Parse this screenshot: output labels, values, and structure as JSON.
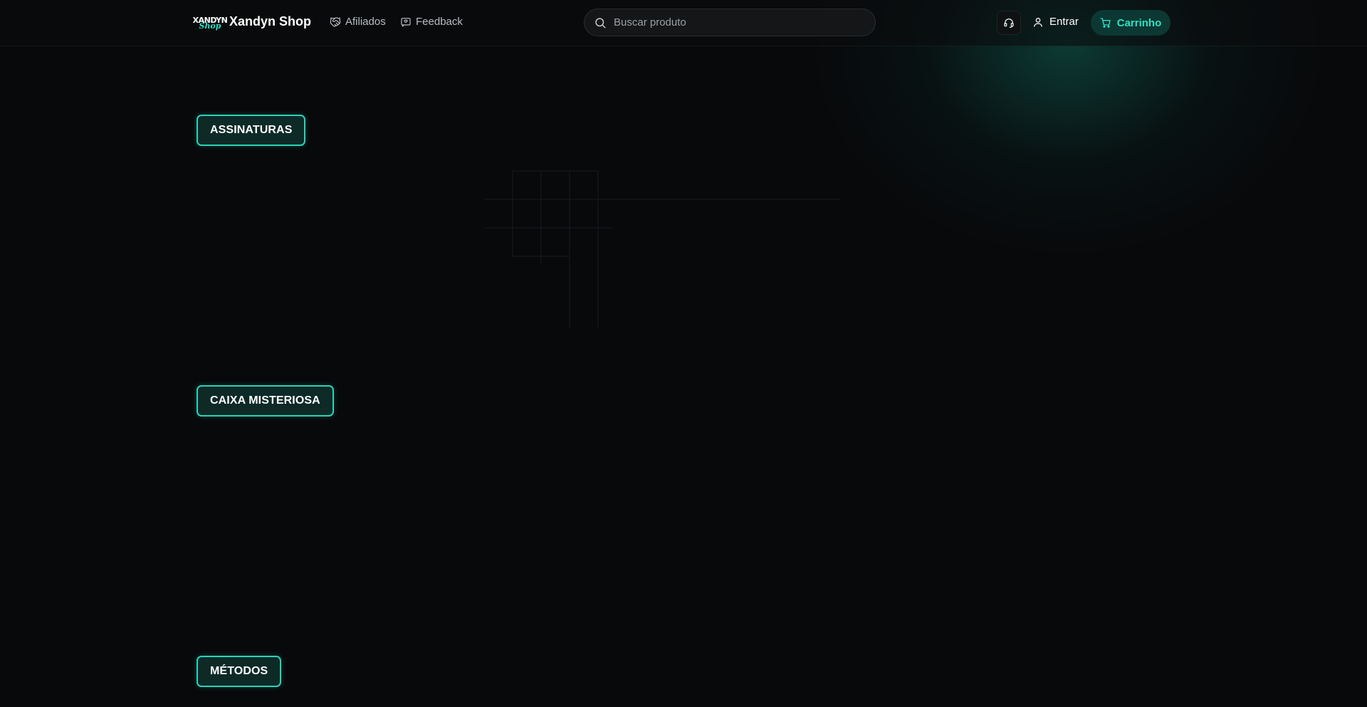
{
  "header": {
    "logo": {
      "top": "XANDYN",
      "bottom": "Shop"
    },
    "brand": "Xandyn Shop",
    "nav": [
      {
        "label": "Afiliados",
        "icon": "handshake-icon"
      },
      {
        "label": "Feedback",
        "icon": "message-square-icon"
      }
    ],
    "search": {
      "placeholder": "Buscar produto",
      "icon": "search-icon"
    },
    "support": {
      "icon": "headset-icon"
    },
    "login": {
      "label": "Entrar",
      "icon": "user-icon"
    },
    "cart": {
      "label": "Carrinho",
      "icon": "cart-icon"
    }
  },
  "sections": [
    {
      "label": "ASSINATURAS"
    },
    {
      "label": "CAIXA MISTERIOSA"
    },
    {
      "label": "MÉTODOS"
    }
  ],
  "colors": {
    "background": "#08090b",
    "accent": "#2ee0c4",
    "tag_border": "#2ad3b8",
    "cart_bg": "#0c3833"
  }
}
